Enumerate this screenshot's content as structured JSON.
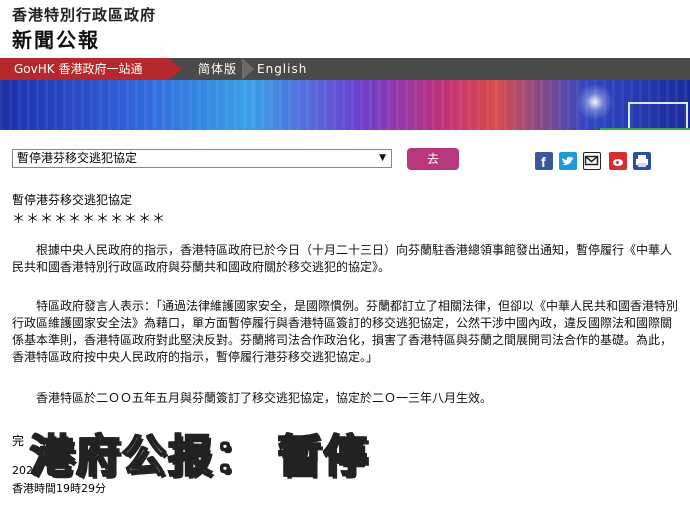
{
  "header": {
    "gov_name": "香港特別行政區政府",
    "press_title": "新聞公報"
  },
  "nav": {
    "govhk": "GovHK 香港政府一站通",
    "simplified": "简体版",
    "english": "English"
  },
  "selector": {
    "selected": "暫停港芬移交逃犯協定",
    "go_label": "去"
  },
  "share_icons": [
    "facebook-icon",
    "twitter-icon",
    "email-icon",
    "weibo-icon",
    "print-icon"
  ],
  "article": {
    "title": "暫停港芬移交逃犯協定",
    "stars": "＊＊＊＊＊＊＊＊＊＊＊",
    "paragraphs": [
      "根據中央人民政府的指示，香港特區政府已於今日（十月二十三日）向芬蘭駐香港總領事館發出通知，暫停履行《中華人民共和國香港特別行政區政府與芬蘭共和國政府關於移交逃犯的協定》。",
      "特區政府發言人表示：「通過法律維護國家安全，是國際慣例。芬蘭都訂立了相關法律，但卻以《中華人民共和國香港特別行政區維護國家安全法》為藉口，單方面暫停履行與香港特區簽訂的移交逃犯協定，公然干涉中國內政，違反國際法和國際關係基本準則，香港特區政府對此堅決反對。芬蘭將司法合作政治化，損害了香港特區與芬蘭之間展開司法合作的基礎。為此，香港特區政府按中央人民政府的指示，暫停履行港芬移交逃犯協定。」",
      "香港特區於二ＯＯ五年五月與芬蘭簽訂了移交逃犯協定，協定於二Ｏ一三年八月生效。"
    ],
    "end_mark": "完",
    "date": "2020",
    "time": "香港時間19時29分"
  },
  "overlay_caption": "港府公报： 暂停"
}
